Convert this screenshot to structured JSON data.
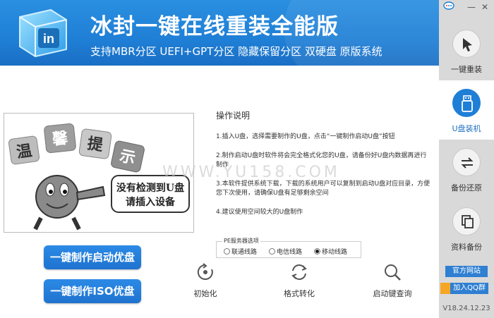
{
  "header": {
    "title": "冰封一键在线重装全能版",
    "subtitle": "支持MBR分区  UEFI+GPT分区  隐藏保留分区  双硬盘  原版系统",
    "logo_text": "in"
  },
  "window": {
    "chat_icon": "chat-bubble-icon",
    "min_label": "—",
    "close_label": "✕"
  },
  "sidebar": {
    "items": [
      {
        "label": "一键重装",
        "icon": "cursor-icon",
        "active": false
      },
      {
        "label": "U盘装机",
        "icon": "usb-icon",
        "active": true
      },
      {
        "label": "备份还原",
        "icon": "sync-icon",
        "active": false
      },
      {
        "label": "资料备份",
        "icon": "copy-icon",
        "active": false
      }
    ],
    "official_site": "官方网站",
    "join_qq": "加入QQ群",
    "version": "V18.24.12.23"
  },
  "tip_image": {
    "banner": [
      "温",
      "馨",
      "提",
      "示"
    ],
    "message_line1": "没有检测到U盘",
    "message_line2": "请插入设备"
  },
  "watermark": "WWW.YU158.COM",
  "buttons": {
    "make_boot_usb": "一键制作启动优盘",
    "make_iso_usb": "一键制作ISO优盘"
  },
  "instructions": {
    "title": "操作说明",
    "items": [
      "1.插入U盘，选择需要制作的U盘，点击“一键制作启动U盘”按钮",
      "2.制作启动U盘时软件将会完全格式化您的U盘，请备份好U盘内数据再进行制作",
      "3.本软件提供系统下载，下载的系统用户可以复制到启动U盘对应目录，方便您下次使用，请确保U盘有足够剩余空间",
      "4.建议使用空间较大的U盘制作"
    ]
  },
  "pe_server": {
    "legend": "PE服务器选项",
    "options": [
      "联通线路",
      "电信线路",
      "移动线路"
    ],
    "selected": "移动线路"
  },
  "tools": [
    {
      "label": "初始化",
      "icon": "restart-icon"
    },
    {
      "label": "格式转化",
      "icon": "convert-icon"
    },
    {
      "label": "启动键查询",
      "icon": "search-icon"
    }
  ],
  "colors": {
    "brand_blue": "#1f7fd6",
    "sidebar_gray": "#d9d9d9",
    "button_blue": "#2b8ae6"
  }
}
